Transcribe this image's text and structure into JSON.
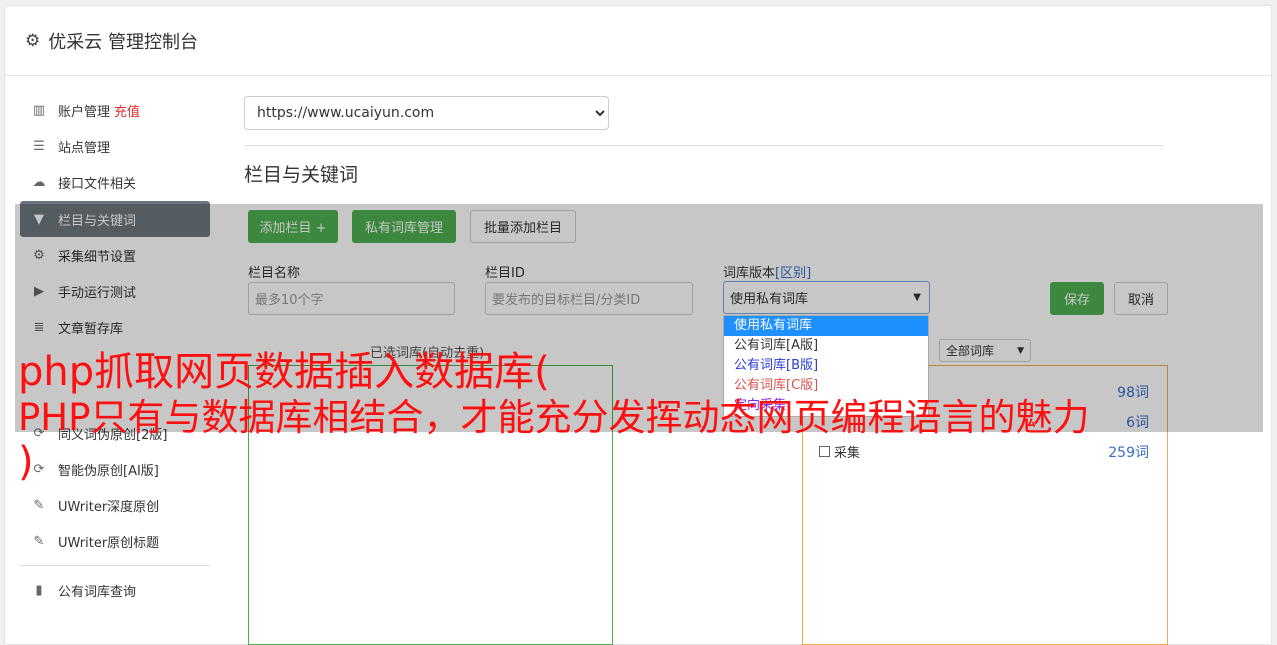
{
  "header": {
    "title": "优采云 管理控制台"
  },
  "sidebar": {
    "items": [
      {
        "label": "账户管理",
        "extra": "充值"
      },
      {
        "label": "站点管理"
      },
      {
        "label": "接口文件相关"
      },
      {
        "label": "栏目与关键词"
      },
      {
        "label": "采集细节设置"
      },
      {
        "label": "手动运行测试"
      },
      {
        "label": "文章暂存库"
      },
      {
        "label": "同义词伪原创[2版]"
      },
      {
        "label": "智能伪原创[AI版]"
      },
      {
        "label": "UWriter深度原创"
      },
      {
        "label": "UWriter原创标题"
      },
      {
        "label": "公有词库查询"
      }
    ]
  },
  "main": {
    "site_select": "https://www.ucaiyun.com",
    "section_title": "栏目与关键词",
    "toolbar": {
      "add": "添加栏目 +",
      "private": "私有词库管理",
      "batch": "批量添加栏目"
    },
    "form": {
      "name_label": "栏目名称",
      "name_placeholder": "最多10个字",
      "id_label": "栏目ID",
      "id_placeholder": "要发布的目标栏目/分类ID",
      "version_label": "词库版本",
      "version_link": "[区别]",
      "version_value": "使用私有词库",
      "save": "保存",
      "cancel": "取消"
    },
    "dropdown_options": [
      "使用私有词库",
      "公有词库[A版]",
      "公有词库[B版]",
      "公有词库[C版]",
      "定向采集"
    ],
    "selected_label": "已选词库(自动去重)",
    "filter_select": "全部词库",
    "right_list": [
      {
        "count": "98词"
      },
      {
        "count": "6词"
      },
      {
        "label": "采集",
        "count": "259词"
      }
    ]
  },
  "overlay_text": {
    "line1": "php抓取网页数据插入数据库(",
    "line2": "PHP只有与数据库相结合，才能充分发挥动态网页编程语言的魅力",
    "line3": ")"
  },
  "colors": {
    "accent_green": "#4caf50",
    "danger_red": "#e12b2b",
    "headline_red": "#ff0f0f"
  }
}
